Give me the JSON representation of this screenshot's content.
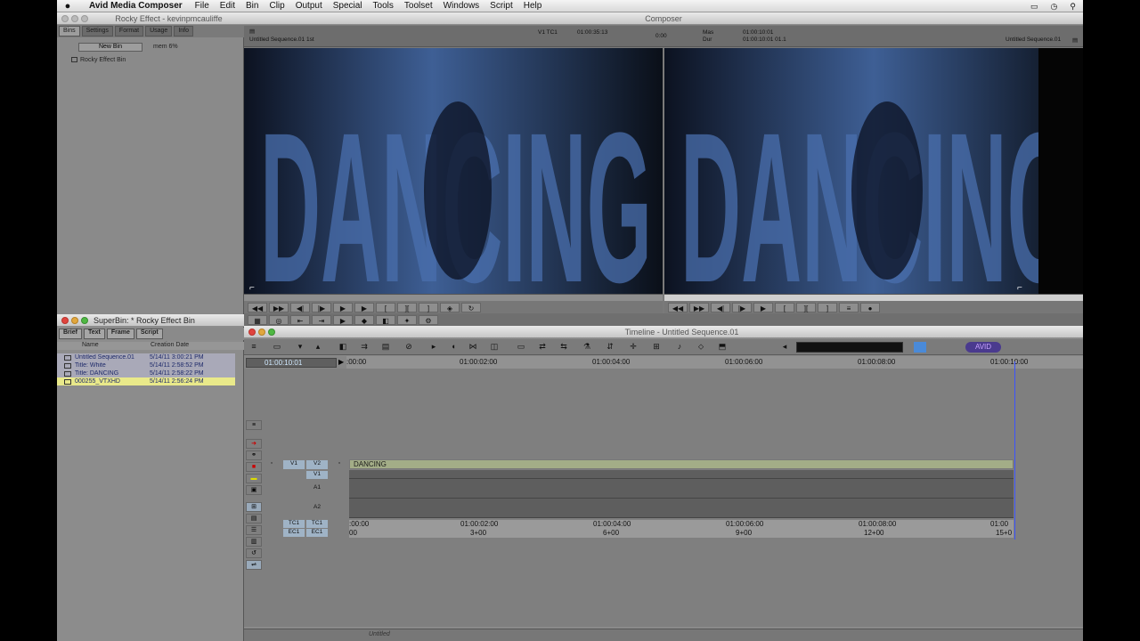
{
  "menubar": {
    "apple": "",
    "app": "Avid Media Composer",
    "items": [
      "File",
      "Edit",
      "Bin",
      "Clip",
      "Output",
      "Special",
      "Tools",
      "Toolset",
      "Windows",
      "Script",
      "Help"
    ]
  },
  "bin_window": {
    "title": "Rocky Effect - kevinpmcauliffe",
    "tabs": [
      "Bins",
      "Settings",
      "Format",
      "Usage",
      "Info"
    ],
    "new_bin_label": "New Bin",
    "mem": "mem 6%",
    "bin_item": "Rocky Effect Bin"
  },
  "superbin": {
    "title": "SuperBin: * Rocky Effect Bin",
    "tabs": [
      "Brief",
      "Text",
      "Frame",
      "Script"
    ],
    "col_name": "Name",
    "col_date": "Creation Date",
    "rows": [
      {
        "name": "Untitled Sequence.01",
        "date": "5/14/11 3:00:21 PM"
      },
      {
        "name": "Title: White",
        "date": "5/14/11 2:58:52 PM"
      },
      {
        "name": "Title: DANCING",
        "date": "5/14/11 2:58:22 PM"
      },
      {
        "name": "000255_VTXHD",
        "date": "5/14/11 2:56:24 PM"
      }
    ]
  },
  "composer": {
    "title": "Composer",
    "left_name": "Untitled Sequence.01 1st",
    "v1tc1": "V1  TC1",
    "tc_left": "01:00:35:13",
    "dur": "0:00",
    "mas": "Mas",
    "dur2": "Dur",
    "tc_right": "01:00:10:01",
    "tc_right2": "01:00:10:01  01.1",
    "right_name": "Untitled Sequence.01",
    "image_text": "DANCING"
  },
  "timeline": {
    "title": "Timeline - Untitled Sequence.01",
    "tc_display": "01:00:10:01",
    "ruler": [
      ":00:00",
      "01:00:02:00",
      "01:00:04:00",
      "01:00:06:00",
      "01:00:08:00",
      "01:00:10:00"
    ],
    "tracks": {
      "v1": "V1",
      "v2": "V2",
      "v1b": "V1",
      "a1": "A1",
      "a2": "A2",
      "tc1": "TC1",
      "ec1": "EC1"
    },
    "clip_label": "DANCING",
    "tc_row": [
      ":00:00",
      "01:00:02:00",
      "01:00:04:00",
      "01:00:06:00",
      "01:00:08:00",
      "01:00"
    ],
    "ec_row": [
      "00",
      "3+00",
      "6+00",
      "9+00",
      "12+00",
      "15+0"
    ],
    "bottom_label": "Untitled"
  }
}
